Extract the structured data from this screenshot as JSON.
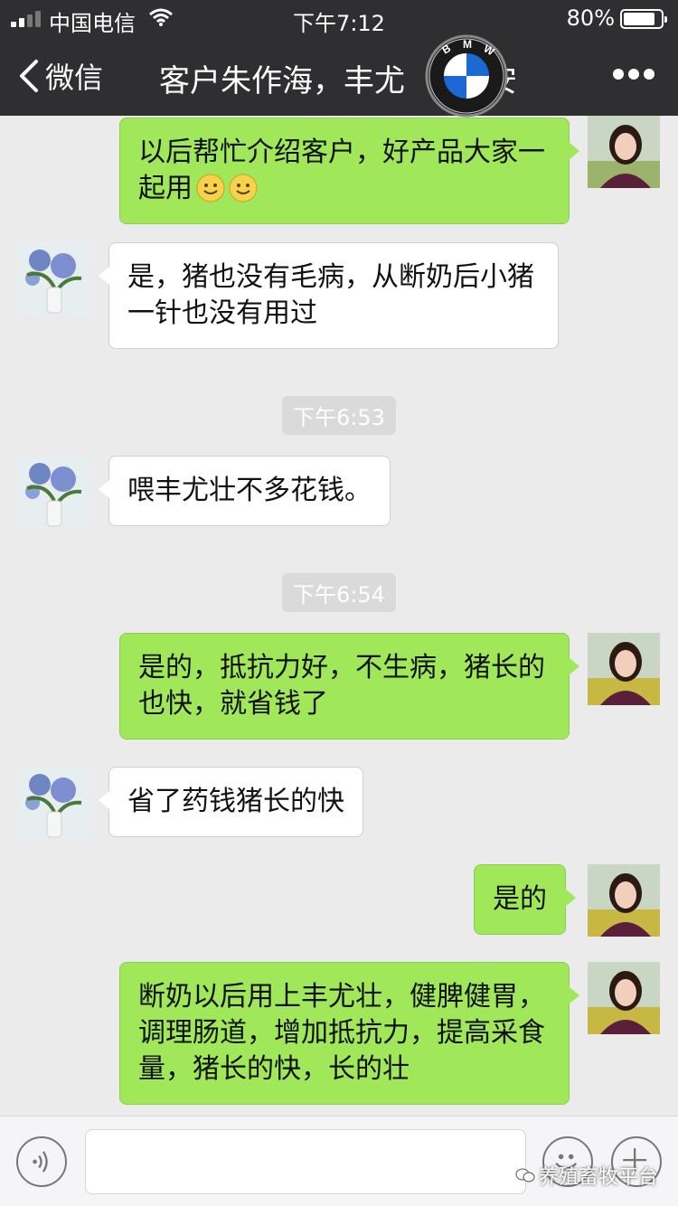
{
  "status_bar": {
    "carrier": "中国电信",
    "time": "下午7:12",
    "battery": "80%",
    "battery_level": 0.8
  },
  "nav": {
    "back_label": "微信",
    "title": "客户朱作海，丰尤",
    "title_tail": "安"
  },
  "logo": {
    "letters": "BMW"
  },
  "messages": [
    {
      "side": "right",
      "text": "以后帮忙介绍客户，好产品大家一起用",
      "emojis": [
        "smile-emoji",
        "smile-emoji"
      ]
    },
    {
      "side": "left",
      "text": "是，猪也没有毛病，从断奶后小猪一针也没有用过"
    },
    {
      "type": "time",
      "text": "下午6:53"
    },
    {
      "side": "left",
      "text": "喂丰尤壮不多花钱。"
    },
    {
      "type": "time",
      "text": "下午6:54"
    },
    {
      "side": "right",
      "text": "是的，抵抗力好，不生病，猪长的也快，就省钱了"
    },
    {
      "side": "left",
      "text": "省了药钱猪长的快"
    },
    {
      "side": "right",
      "text": "是的"
    },
    {
      "side": "right",
      "text": "断奶以后用上丰尤壮，健脾健胃，调理肠道，增加抵抗力，提高采食量，猪长的快，长的壮"
    }
  ],
  "input": {
    "value": ""
  },
  "watermark": "养殖畜牧平台",
  "colors": {
    "bar_bg": "#2f2f31",
    "chat_bg": "#ebebeb",
    "sent_bubble": "#a0e75a",
    "received_bubble": "#ffffff"
  },
  "icons": [
    "signal-icon",
    "wifi-icon",
    "battery-icon",
    "back-chevron-icon",
    "more-icon",
    "voice-icon",
    "emoji-icon",
    "plus-icon",
    "wechat-icon"
  ]
}
